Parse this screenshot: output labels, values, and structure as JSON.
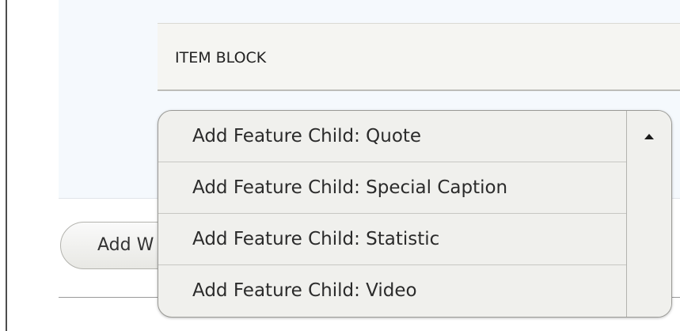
{
  "item_block": {
    "label": "ITEM BLOCK"
  },
  "add_button": {
    "label": "Add W"
  },
  "dropdown": {
    "options": [
      {
        "label": "Add Feature Child: Quote"
      },
      {
        "label": "Add Feature Child: Special Caption"
      },
      {
        "label": "Add Feature Child: Statistic"
      },
      {
        "label": "Add Feature Child: Video"
      }
    ],
    "scroll_icon": "chevron-up-icon"
  },
  "colors": {
    "panel_background": "#f5f9fd",
    "item_block_background": "#f5f5f2",
    "dropdown_background": "#f0f0ed",
    "text": "#2b2b2b"
  }
}
